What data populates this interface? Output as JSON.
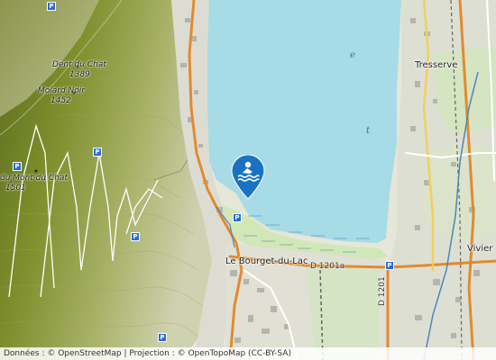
{
  "map": {
    "peaks": [
      {
        "name": "Dent du Chat",
        "elevation": "1389"
      },
      {
        "name": "Molard Noir",
        "elevation": "1452"
      },
      {
        "name": "du Mont du Chat",
        "elevation": "1501"
      }
    ],
    "towns": {
      "tresserve": "Tresserve",
      "bourget": "Le Bourget-du-Lac",
      "viviers": "Vivier"
    },
    "roads": {
      "d1201a": "D 1201a",
      "d1201": "D 1201"
    },
    "lake_letters": [
      "e",
      "t"
    ],
    "marker": {
      "type": "swimming",
      "icon": "swimmer-icon",
      "color": "#1a73c2"
    },
    "colors": {
      "lake": "#a7dbe6",
      "forest": "#8fa13a",
      "marker": "#1a73c2"
    }
  },
  "attribution": "Données : © OpenStreetMap | Projection : © OpenTopoMap (CC-BY-SA)"
}
